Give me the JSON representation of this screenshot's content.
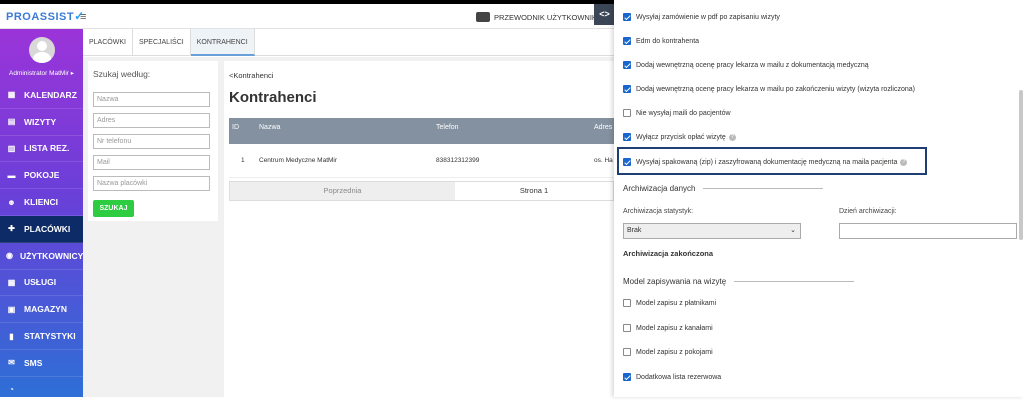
{
  "header": {
    "logo": "PROASSIST",
    "guide": "PRZEWODNIK UŻYTKOWNIKA"
  },
  "sidebar": {
    "user": "Administrator MatMir ▸",
    "items": [
      {
        "icon": "calendar-icon",
        "glyph": "▦",
        "label": "KALENDARZ"
      },
      {
        "icon": "visits-icon",
        "glyph": "▤",
        "label": "WIZYTY"
      },
      {
        "icon": "list-icon",
        "glyph": "▥",
        "label": "LISTA REZ."
      },
      {
        "icon": "rooms-icon",
        "glyph": "▬",
        "label": "POKOJE"
      },
      {
        "icon": "clients-icon",
        "glyph": "☻",
        "label": "KLIENCI"
      },
      {
        "icon": "facilities-icon",
        "glyph": "✚",
        "label": "PLACÓWKI"
      },
      {
        "icon": "users-icon",
        "glyph": "◉",
        "label": "UŻYTKOWNICY"
      },
      {
        "icon": "services-icon",
        "glyph": "▦",
        "label": "USŁUGI"
      },
      {
        "icon": "warehouse-icon",
        "glyph": "▣",
        "label": "MAGAZYN"
      },
      {
        "icon": "stats-icon",
        "glyph": "▮",
        "label": "STATYSTYKI"
      },
      {
        "icon": "sms-icon",
        "glyph": "✉",
        "label": "SMS"
      },
      {
        "icon": "more-icon",
        "glyph": "◔",
        "label": ""
      }
    ],
    "active_index": 5
  },
  "tabs": [
    "PLACÓWKI",
    "SPECJALIŚCI",
    "KONTRAHENCI"
  ],
  "search": {
    "title": "Szukaj według:",
    "fields": [
      "Nazwa",
      "Adres",
      "Nr telefonu",
      "Mail",
      "Nazwa placówki"
    ],
    "button": "SZUKAJ"
  },
  "main": {
    "breadcrumb": "<Kontrahenci",
    "title": "Kontrahenci",
    "columns": [
      "ID",
      "Nazwa",
      "Telefon",
      "Adres"
    ],
    "rows": [
      {
        "id": "1",
        "name": "Centrum Medyczne MatMir",
        "phone": "838312312399",
        "address": "os. Ha"
      }
    ],
    "pager": {
      "prev": "Poprzednia",
      "page": "Strona 1"
    }
  },
  "settings": {
    "checkboxes": [
      {
        "label": "Wysyłaj zamówienie w pdf po zapisaniu wizyty",
        "checked": true,
        "help": false
      },
      {
        "label": "Edm do kontrahenta",
        "checked": true,
        "help": false
      },
      {
        "label": "Dodaj wewnętrzną ocenę pracy lekarza w mailu z dokumentacją medyczną",
        "checked": true,
        "help": false
      },
      {
        "label": "Dodaj wewnętrzną ocenę pracy lekarza w mailu po zakończeniu wizyty (wizyta rozliczona)",
        "checked": true,
        "help": false
      },
      {
        "label": "Nie wysyłaj maili do pacjentów",
        "checked": false,
        "help": false
      },
      {
        "label": "Wyłącz przycisk opłać wizytę",
        "checked": true,
        "help": true
      },
      {
        "label": "Wysyłaj spakowaną (zip) i zaszyfrowaną dokumentację medyczną na maila pacjenta",
        "checked": true,
        "help": true
      }
    ],
    "archiving": {
      "section": "Archiwizacja danych",
      "stats_label": "Archiwizacja statystyk:",
      "stats_value": "Brak",
      "day_label": "Dzień archiwizacji:",
      "done": "Archiwizacja zakończona"
    },
    "save_model": {
      "section": "Model zapisywania na wizytę",
      "options": [
        {
          "label": "Model zapisu z płatnikami",
          "checked": false
        },
        {
          "label": "Model zapisu z kanałami",
          "checked": false
        },
        {
          "label": "Model zapisu z pokojami",
          "checked": false
        },
        {
          "label": "Dodatkowa lista rezerwowa",
          "checked": true
        }
      ]
    }
  }
}
